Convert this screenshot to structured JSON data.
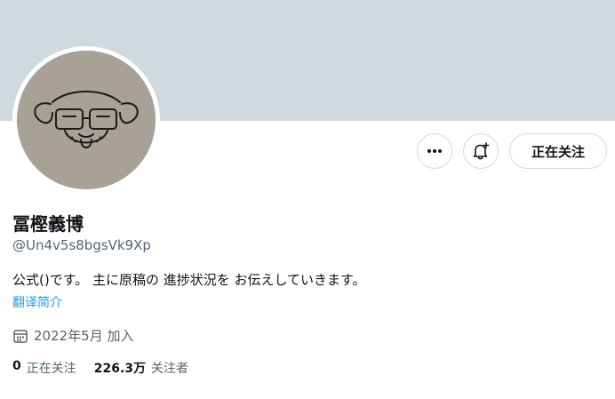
{
  "profile": {
    "display_name": "冨樫義博",
    "handle": "@Un4v5s8bgsVk9Xp",
    "bio": "公式()です。 主に原稿の 進捗状況を お伝えしていきます。",
    "translate_label": "翻译简介",
    "joined": "2022年5月 加入"
  },
  "actions": {
    "more_icon": "more-horizontal-icon",
    "notify_icon": "bell-plus-icon",
    "follow_label": "正在关注"
  },
  "stats": {
    "following_count": "0",
    "following_label": "正在关注",
    "followers_count": "226.3万",
    "followers_label": "关注者"
  },
  "colors": {
    "banner": "#cfd9de",
    "link": "#1d9bf0",
    "secondary_text": "#536471"
  }
}
